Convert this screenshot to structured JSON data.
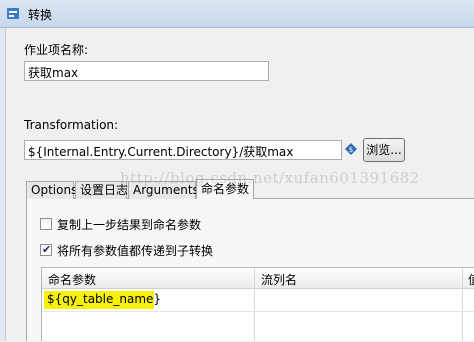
{
  "window": {
    "title": "转换"
  },
  "job_name": {
    "label": "作业项名称:",
    "value": "获取max"
  },
  "transformation": {
    "label": "Transformation:",
    "value": "${Internal.Entry.Current.Directory}/获取max",
    "browse_label": "浏览..."
  },
  "tabs": [
    "Options",
    "设置日志",
    "Arguments",
    "命名参数"
  ],
  "options": {
    "copy_results": {
      "label": "复制上一步结果到命名参数",
      "checked": false
    },
    "pass_all": {
      "label": "将所有参数值都传递到子转换",
      "checked": true
    }
  },
  "grid": {
    "columns": [
      "命名参数",
      "流列名",
      "值"
    ],
    "rows": [
      [
        "${qy_table_name}",
        "",
        ""
      ]
    ]
  },
  "watermark": "http://blog.csdn.net/xufan601391682",
  "colors": {
    "highlight": "#f6f10a"
  }
}
